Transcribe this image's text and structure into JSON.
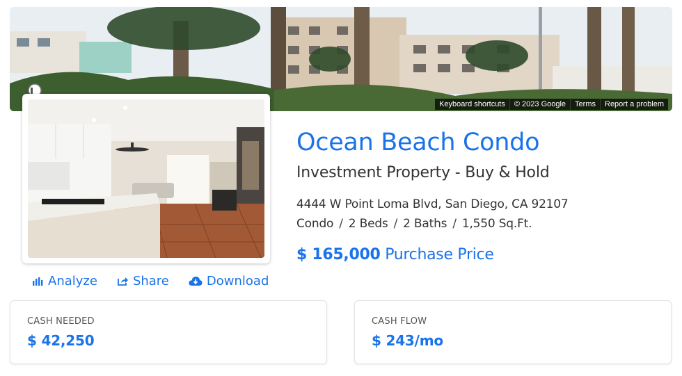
{
  "street_view": {
    "attribution": [
      "Keyboard shortcuts",
      "© 2023 Google",
      "Terms",
      "Report a problem"
    ]
  },
  "property": {
    "title": "Ocean Beach Condo",
    "subtitle": "Investment Property - Buy & Hold",
    "address": "4444 W Point Loma Blvd, San Diego, CA 92107",
    "details": [
      "Condo",
      "2 Beds",
      "2 Baths",
      "1,550 Sq.Ft."
    ],
    "detail_separator": "/",
    "price_amount": "$ 165,000",
    "price_label": "Purchase Price"
  },
  "actions": [
    {
      "label": "Analyze",
      "icon": "bar-chart-icon"
    },
    {
      "label": "Share",
      "icon": "share-icon"
    },
    {
      "label": "Download",
      "icon": "cloud-download-icon"
    }
  ],
  "metrics": {
    "cash_needed": {
      "label": "CASH NEEDED",
      "value": "$ 42,250"
    },
    "cash_flow": {
      "label": "CASH FLOW",
      "value": "$ 243/mo"
    }
  },
  "colors": {
    "accent": "#1a73e8",
    "text": "#333333"
  }
}
